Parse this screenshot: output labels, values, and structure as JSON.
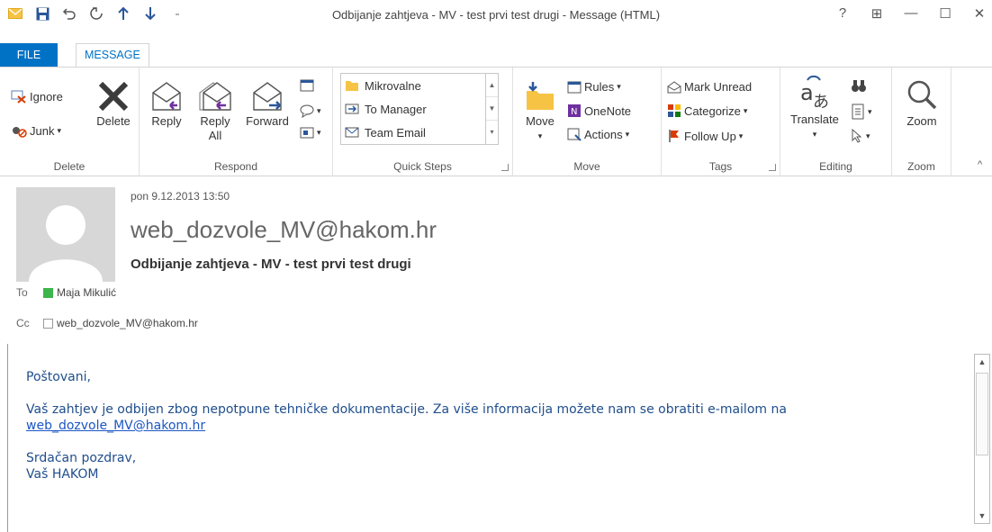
{
  "window": {
    "title": "Odbijanje zahtjeva - MV - test prvi test drugi - Message (HTML)",
    "controls": [
      "?",
      "⊞",
      "—",
      "☐",
      "✕"
    ]
  },
  "qat": [
    "mail-icon",
    "save-icon",
    "undo-icon",
    "redo-icon",
    "up-arrow-icon",
    "down-arrow-icon",
    "customize-icon"
  ],
  "tabs": {
    "file": "FILE",
    "message": "MESSAGE"
  },
  "ribbon": {
    "delete_group": {
      "label": "Delete",
      "ignore": "Ignore",
      "junk": "Junk",
      "delete": "Delete"
    },
    "respond_group": {
      "label": "Respond",
      "reply": "Reply",
      "reply_all_1": "Reply",
      "reply_all_2": "All",
      "forward": "Forward"
    },
    "quicksteps_group": {
      "label": "Quick Steps",
      "items": [
        "Mikrovalne",
        "To Manager",
        "Team Email"
      ]
    },
    "move_group": {
      "label": "Move",
      "move": "Move",
      "rules": "Rules",
      "onenote": "OneNote",
      "actions": "Actions"
    },
    "tags_group": {
      "label": "Tags",
      "mark_unread": "Mark Unread",
      "categorize": "Categorize",
      "follow_up": "Follow Up"
    },
    "editing_group": {
      "label": "Editing",
      "translate": "Translate"
    },
    "zoom_group": {
      "label": "Zoom",
      "zoom": "Zoom"
    }
  },
  "header": {
    "sent": "pon 9.12.2013 13:50",
    "sender": "web_dozvole_MV@hakom.hr",
    "subject": "Odbijanje zahtjeva - MV - test prvi test drugi",
    "to_label": "To",
    "to_name": "Maja Mikulić",
    "cc_label": "Cc",
    "cc_name": "web_dozvole_MV@hakom.hr"
  },
  "body": {
    "greeting": "Poštovani,",
    "paragraph": "Vaš zahtjev je odbijen zbog nepotpune tehničke dokumentacije. Za više informacija možete nam se obratiti e-mailom na",
    "link": "web_dozvole_MV@hakom.hr",
    "closing_1": "Srdačan pozdrav,",
    "closing_2": "Vaš HAKOM"
  },
  "colors": {
    "accent": "#0072c6",
    "to_status": "#3cb54a",
    "body_text": "#1f4e8c"
  }
}
